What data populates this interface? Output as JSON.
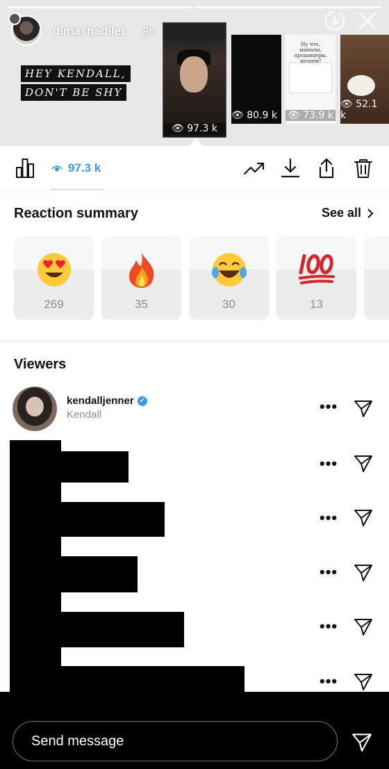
{
  "story": {
    "username": "dimashadilet",
    "posted": "8h",
    "caption_line1": "HEY KENDALL,",
    "caption_line2": "DON'T BE SHY",
    "thumbnails": [
      {
        "views": "97.3 k"
      },
      {
        "views": "80.9 k"
      },
      {
        "views": "73.9 k",
        "text": "Ну что, мамалы, продавцеры, делаем?"
      },
      {
        "views": "52.1 k"
      }
    ]
  },
  "toolbar": {
    "views": "97.3 k",
    "icons": [
      "bar-chart-icon",
      "eye-icon",
      "trending-icon",
      "download-icon",
      "share-icon",
      "trash-icon"
    ]
  },
  "reactions": {
    "title": "Reaction summary",
    "see_all": "See all",
    "items": [
      {
        "emoji": "heart-eyes",
        "count": "269"
      },
      {
        "emoji": "fire",
        "count": "35"
      },
      {
        "emoji": "joy",
        "count": "30"
      },
      {
        "emoji": "hundred",
        "count": "13"
      }
    ]
  },
  "viewers": {
    "title": "Viewers",
    "list": [
      {
        "username": "kendalljenner",
        "name": "Kendall",
        "verified": true
      }
    ]
  },
  "message": {
    "placeholder": "Send message"
  },
  "colors": {
    "accent": "#3897f0",
    "muted": "#8e8e8e"
  }
}
